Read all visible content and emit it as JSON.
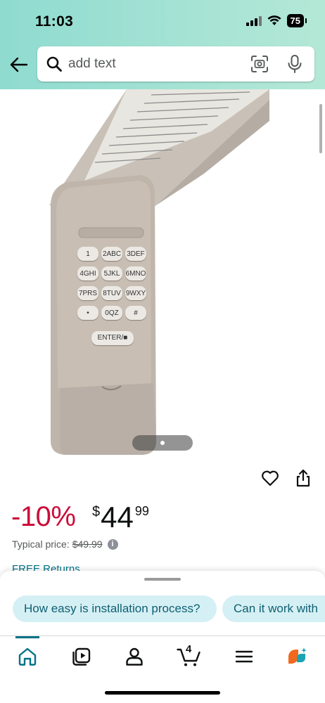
{
  "status_bar": {
    "time": "11:03",
    "battery": "75"
  },
  "search": {
    "placeholder": "add text",
    "value": ""
  },
  "product": {
    "image_keypad": {
      "keys": [
        "1",
        "2ABC",
        "3DEF",
        "4GHI",
        "5JKL",
        "6MNO",
        "7PRS",
        "8TUV",
        "9WXY",
        "•",
        "0QZ",
        "#"
      ],
      "enter_label": "ENTER/■"
    },
    "image_count": 1,
    "current_image": 1
  },
  "pricing": {
    "discount": "-10%",
    "currency": "$",
    "price_whole": "44",
    "price_fraction": "99",
    "typical_label": "Typical price:",
    "typical_price": "$49.99",
    "info_glyph": "i",
    "free_returns": "FREE Returns"
  },
  "suggestions": [
    {
      "label": "How easy is installation process?"
    },
    {
      "label": "Can it work with"
    }
  ],
  "bottom_nav": {
    "items": [
      "home-icon",
      "video-icon",
      "account-icon",
      "cart-icon",
      "menu-icon",
      "rufus-icon"
    ],
    "cart_count": "4",
    "accent": "#007185"
  },
  "colors": {
    "header_gradient_start": "#8fdbd0",
    "header_gradient_end": "#b4e8d6",
    "discount": "#cc0c39",
    "link": "#007185",
    "chip_bg": "#d5f0f4"
  }
}
